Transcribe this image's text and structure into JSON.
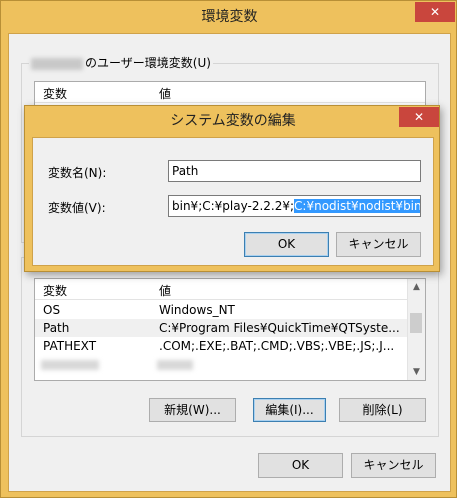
{
  "window": {
    "title": "環境変数",
    "close_glyph": "✕",
    "ok_label": "OK",
    "cancel_label": "キャンセル"
  },
  "user_section": {
    "label": "のユーザー環境変数(U)",
    "col_variable": "変数",
    "col_value": "値"
  },
  "system_section": {
    "col_variable": "変数",
    "col_value": "値",
    "rows": [
      {
        "name": "OS",
        "value": "Windows_NT"
      },
      {
        "name": "Path",
        "value": "C:¥Program Files¥QuickTime¥QTSyste..."
      },
      {
        "name": "PATHEXT",
        "value": ".COM;.EXE;.BAT;.CMD;.VBS;.VBE;.JS;.J..."
      }
    ],
    "new_label": "新規(W)...",
    "edit_label": "編集(I)...",
    "delete_label": "削除(L)"
  },
  "edit_dialog": {
    "title": "システム変数の編集",
    "close_glyph": "✕",
    "name_label": "変数名(N):",
    "name_value": "Path",
    "value_label": "変数値(V):",
    "value_plain": "bin¥;C:¥play-2.2.2¥;",
    "value_selected": "C:¥nodist¥nodist¥bin;",
    "ok_label": "OK",
    "cancel_label": "キャンセル"
  },
  "colors": {
    "title_bar": "#eec15d",
    "close_button": "#c9463d",
    "selection": "#3399ff"
  }
}
